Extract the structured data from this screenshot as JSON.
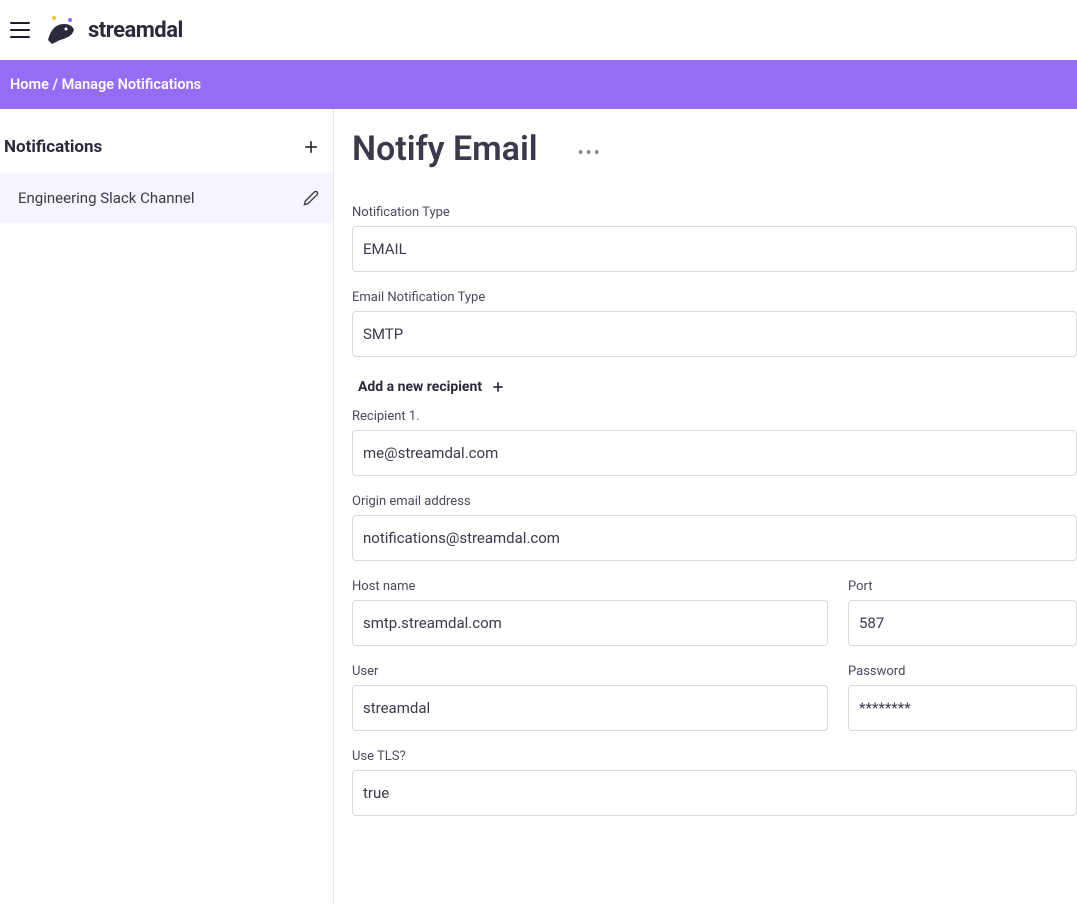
{
  "header": {
    "brand": "streamdal"
  },
  "breadcrumb": {
    "home": "Home",
    "separator": " / ",
    "current": "Manage Notifications"
  },
  "sidebar": {
    "title": "Notifications",
    "items": [
      {
        "label": "Engineering Slack Channel"
      }
    ]
  },
  "main": {
    "title": "Notify Email",
    "fields": {
      "notification_type": {
        "label": "Notification Type",
        "value": "EMAIL"
      },
      "email_notification_type": {
        "label": "Email Notification Type",
        "value": "SMTP"
      },
      "add_recipient_label": "Add a new recipient",
      "recipient_1": {
        "label": "Recipient 1.",
        "value": "me@streamdal.com"
      },
      "origin_email": {
        "label": "Origin email address",
        "value": "notifications@streamdal.com"
      },
      "host_name": {
        "label": "Host name",
        "value": "smtp.streamdal.com"
      },
      "port": {
        "label": "Port",
        "value": "587"
      },
      "user": {
        "label": "User",
        "value": "streamdal"
      },
      "password": {
        "label": "Password",
        "value": "********"
      },
      "use_tls": {
        "label": "Use TLS?",
        "value": "true"
      }
    }
  }
}
